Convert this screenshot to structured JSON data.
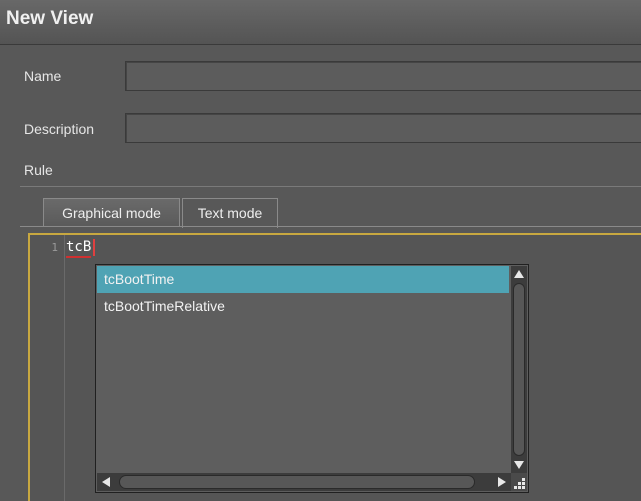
{
  "window": {
    "title": "New View"
  },
  "form": {
    "name_label": "Name",
    "name_value": "",
    "description_label": "Description",
    "description_value": "",
    "rule_label": "Rule"
  },
  "tabs": [
    {
      "label": "Graphical mode",
      "active": false
    },
    {
      "label": "Text mode",
      "active": true
    }
  ],
  "editor": {
    "line_number": "1",
    "code_text": "tcB"
  },
  "autocomplete": {
    "items": [
      {
        "label": "tcBootTime",
        "selected": true
      },
      {
        "label": "tcBootTimeRelative",
        "selected": false
      }
    ]
  },
  "colors": {
    "selection": "#4fa3b4",
    "editor_border": "#c8a840",
    "caret": "#e04040"
  }
}
